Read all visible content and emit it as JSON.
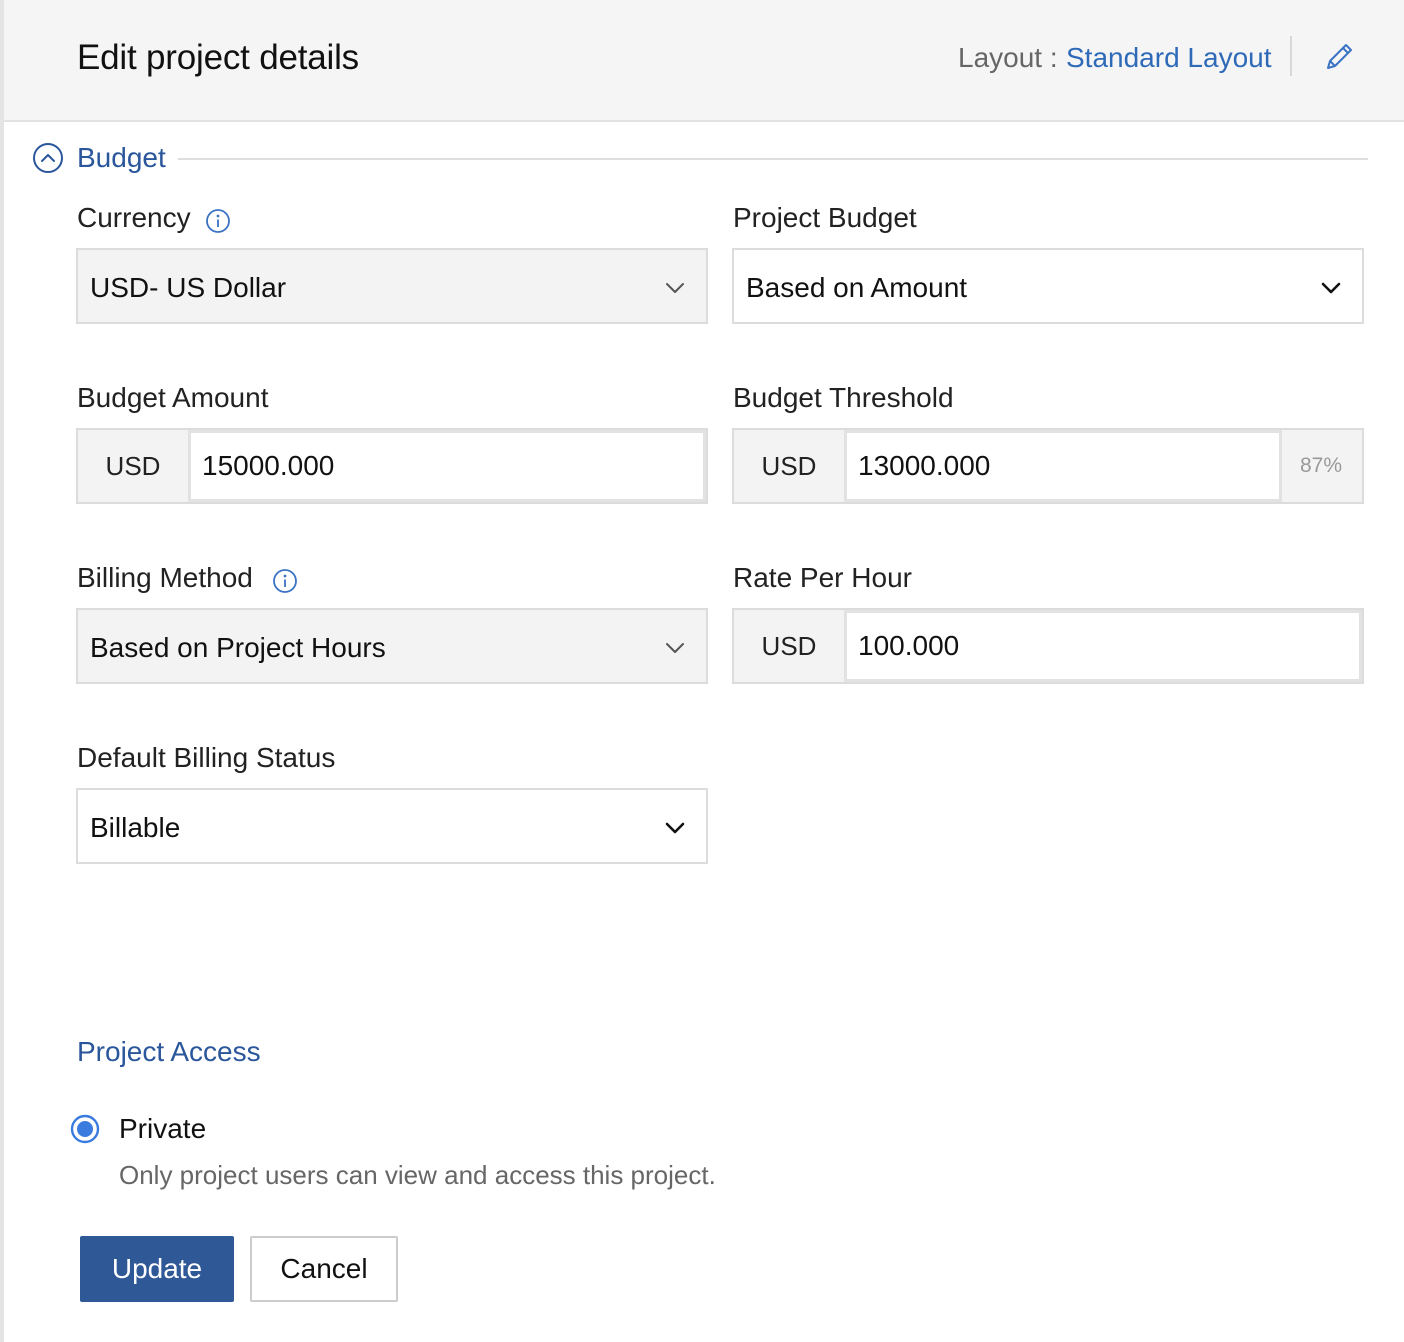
{
  "header": {
    "title": "Edit project details",
    "layout_label": "Layout :",
    "layout_value": "Standard Layout"
  },
  "budget_section": {
    "title": "Budget",
    "currency": {
      "label": "Currency",
      "value": "USD- US Dollar"
    },
    "project_budget": {
      "label": "Project Budget",
      "value": "Based on Amount"
    },
    "budget_amount": {
      "label": "Budget Amount",
      "prefix": "USD",
      "value": "15000.000"
    },
    "budget_threshold": {
      "label": "Budget Threshold",
      "prefix": "USD",
      "value": "13000.000",
      "percent": "87%"
    },
    "billing_method": {
      "label": "Billing Method",
      "value": "Based on Project Hours"
    },
    "rate_per_hour": {
      "label": "Rate Per Hour",
      "prefix": "USD",
      "value": "100.000"
    },
    "default_billing_status": {
      "label": "Default Billing Status",
      "value": "Billable"
    }
  },
  "project_access": {
    "title": "Project Access",
    "option_label": "Private",
    "option_description": "Only project users can view and access this project.",
    "selected": true
  },
  "actions": {
    "update_label": "Update",
    "cancel_label": "Cancel"
  },
  "colors": {
    "accent": "#2a569b",
    "link": "#2e6ab8",
    "primary_button": "#2f5897",
    "radio": "#3a7be0"
  },
  "icons": {
    "edit": "pencil-icon",
    "collapse": "chevron-up-circle-icon",
    "info": "info-icon",
    "dropdown": "chevron-down-icon"
  }
}
